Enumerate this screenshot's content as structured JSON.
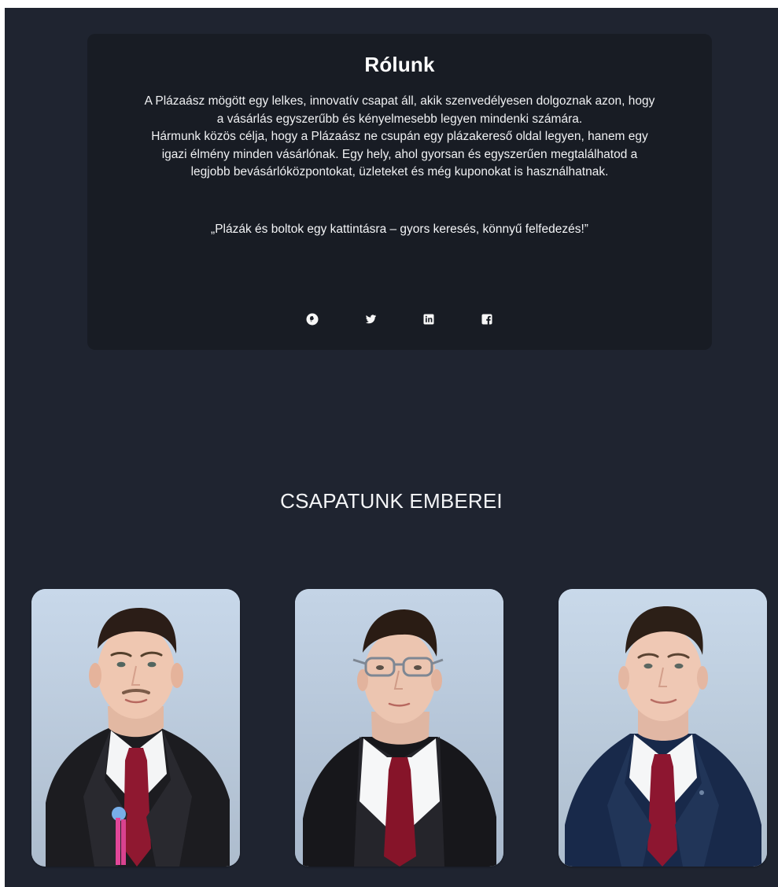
{
  "about": {
    "title": "Rólunk",
    "paragraph_lines": [
      "A Plázaász mögött egy lelkes, innovatív csapat áll, akik szenvedélyesen dolgoznak azon, hogy",
      "a vásárlás egyszerűbb és kényelmesebb legyen mindenki számára.",
      "Hármunk közös célja, hogy a Plázaász ne csupán egy plázakereső oldal legyen, hanem egy",
      "igazi élmény minden vásárlónak. Egy hely, ahol gyorsan és egyszerűen megtalálhatod a",
      "legjobb bevásárlóközpontokat, üzleteket és még kuponokat is használhatnak."
    ],
    "quote": "„Plázák és boltok egy kattintásra – gyors keresés, könnyű felfedezés!”",
    "social": [
      {
        "icon": "github-icon"
      },
      {
        "icon": "twitter-icon"
      },
      {
        "icon": "linkedin-icon"
      },
      {
        "icon": "facebook-icon"
      }
    ]
  },
  "team": {
    "title": "CSAPATUNK EMBEREI",
    "members": [
      {
        "suit": "#1c1c20",
        "tie": "#8f1830",
        "hair": "#2b1d17"
      },
      {
        "suit": "#17171b",
        "tie": "#861429",
        "hair": "#2a1c14"
      },
      {
        "suit": "#18294a",
        "tie": "#8d1630",
        "hair": "#2c1f17"
      }
    ]
  },
  "colors": {
    "page_background": "#1f2430",
    "card_background": "#181c24",
    "text": "#f2f3f5"
  }
}
